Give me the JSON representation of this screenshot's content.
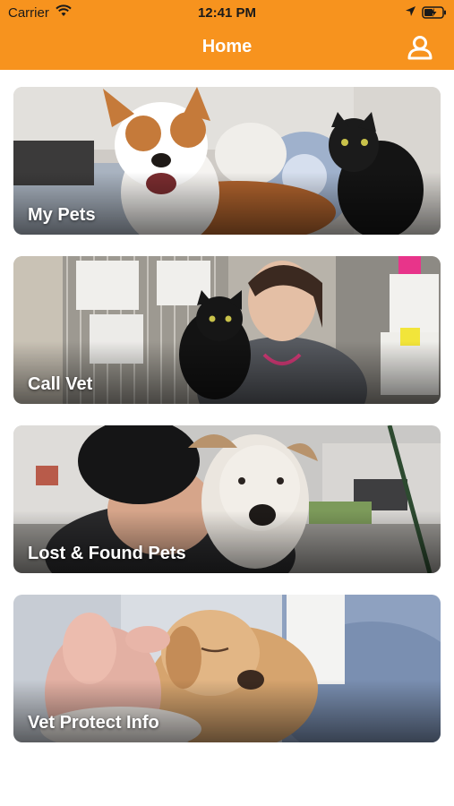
{
  "status_bar": {
    "carrier": "Carrier",
    "time": "12:41 PM",
    "icons": [
      "wifi-icon",
      "location-arrow-icon",
      "battery-charging-icon"
    ]
  },
  "header": {
    "title": "Home",
    "right_icon": "user-profile-icon"
  },
  "cards": [
    {
      "label": "My Pets",
      "image": "dog-and-black-cat-on-couch"
    },
    {
      "label": "Call Vet",
      "image": "vet-holding-black-cat"
    },
    {
      "label": "Lost & Found Pets",
      "image": "person-hugging-terrier"
    },
    {
      "label": "Vet Protect Info",
      "image": "hand-petting-golden-puppy"
    }
  ],
  "colors": {
    "accent": "#f7931e",
    "header_text": "#ffffff",
    "background": "#ffffff"
  }
}
